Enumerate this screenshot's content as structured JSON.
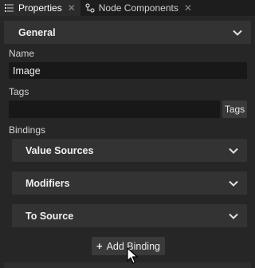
{
  "tabs": [
    {
      "label": "Properties",
      "icon": "list-icon",
      "active": true
    },
    {
      "label": "Node Components",
      "icon": "node-components-icon",
      "active": false
    }
  ],
  "general": {
    "title": "General",
    "name_label": "Name",
    "name_value": "Image",
    "tags_label": "Tags",
    "tags_value": "",
    "tags_button": "Tags",
    "bindings_label": "Bindings"
  },
  "bindings": [
    {
      "label": "Value Sources"
    },
    {
      "label": "Modifiers"
    },
    {
      "label": "To Source"
    }
  ],
  "add_binding": {
    "label": "Add Binding"
  },
  "colors": {
    "background": "#262626",
    "header": "#333333",
    "field": "#181818",
    "button": "#3a3a3a",
    "tabbar": "#1d1d1d"
  }
}
